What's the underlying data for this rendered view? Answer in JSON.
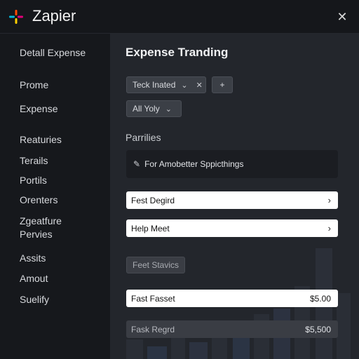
{
  "header": {
    "brand": "Zapier",
    "close_glyph": "✕",
    "logo_icon": "zapier-asterisk-icon",
    "logo_colors": [
      "#ff4a00",
      "#ffd100",
      "#00b8d9",
      "#e2007a"
    ]
  },
  "sidebar": {
    "items": [
      {
        "label": "Detall Expense"
      },
      {
        "label": "Prome"
      },
      {
        "label": "Expense"
      },
      {
        "label": "Reaturies"
      },
      {
        "label": "Terails"
      },
      {
        "label": "Portils"
      },
      {
        "label": "Orenters"
      },
      {
        "label": "Zgeatfure Pervies"
      },
      {
        "label": "Assits"
      },
      {
        "label": "Amout"
      },
      {
        "label": "Suelify"
      }
    ]
  },
  "main": {
    "title": "Expense Tranding",
    "filter_chip": {
      "label": "Teck Inated",
      "chevron_icon": "chevron-down-icon",
      "clear_icon": "close-icon"
    },
    "add_chip": {
      "label": "+"
    },
    "all_chip": {
      "label": "All Yoly",
      "chevron_icon": "chevron-down-icon"
    },
    "section_title": "Parrilies",
    "notice": {
      "icon": "edit-icon",
      "text": "For Amobetter Sppicthings"
    },
    "rows": [
      {
        "label": "Fest Degird"
      },
      {
        "label": "Help Meet"
      }
    ],
    "pill": "Feet Stavics",
    "amount_rows": [
      {
        "label": "Fast Fasset",
        "value": "$5.00"
      },
      {
        "label": "Fask Regrd",
        "value": "$5,500"
      }
    ]
  }
}
